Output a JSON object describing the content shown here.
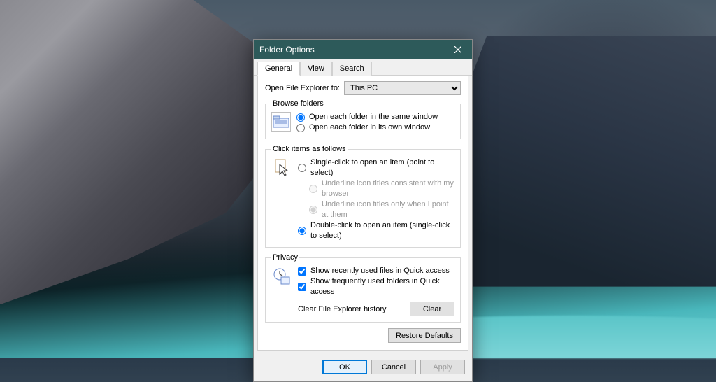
{
  "window": {
    "title": "Folder Options"
  },
  "tabs": {
    "general": "General",
    "view": "View",
    "search": "Search"
  },
  "open_to": {
    "label": "Open File Explorer to:",
    "value": "This PC"
  },
  "browse": {
    "legend": "Browse folders",
    "same": "Open each folder in the same window",
    "own": "Open each folder in its own window"
  },
  "click": {
    "legend": "Click items as follows",
    "single": "Single-click to open an item (point to select)",
    "ul_browser": "Underline icon titles consistent with my browser",
    "ul_point": "Underline icon titles only when I point at them",
    "double": "Double-click to open an item (single-click to select)"
  },
  "privacy": {
    "legend": "Privacy",
    "recent_files": "Show recently used files in Quick access",
    "frequent_folders": "Show frequently used folders in Quick access",
    "clear_label": "Clear File Explorer history",
    "clear_btn": "Clear"
  },
  "buttons": {
    "restore": "Restore Defaults",
    "ok": "OK",
    "cancel": "Cancel",
    "apply": "Apply"
  }
}
